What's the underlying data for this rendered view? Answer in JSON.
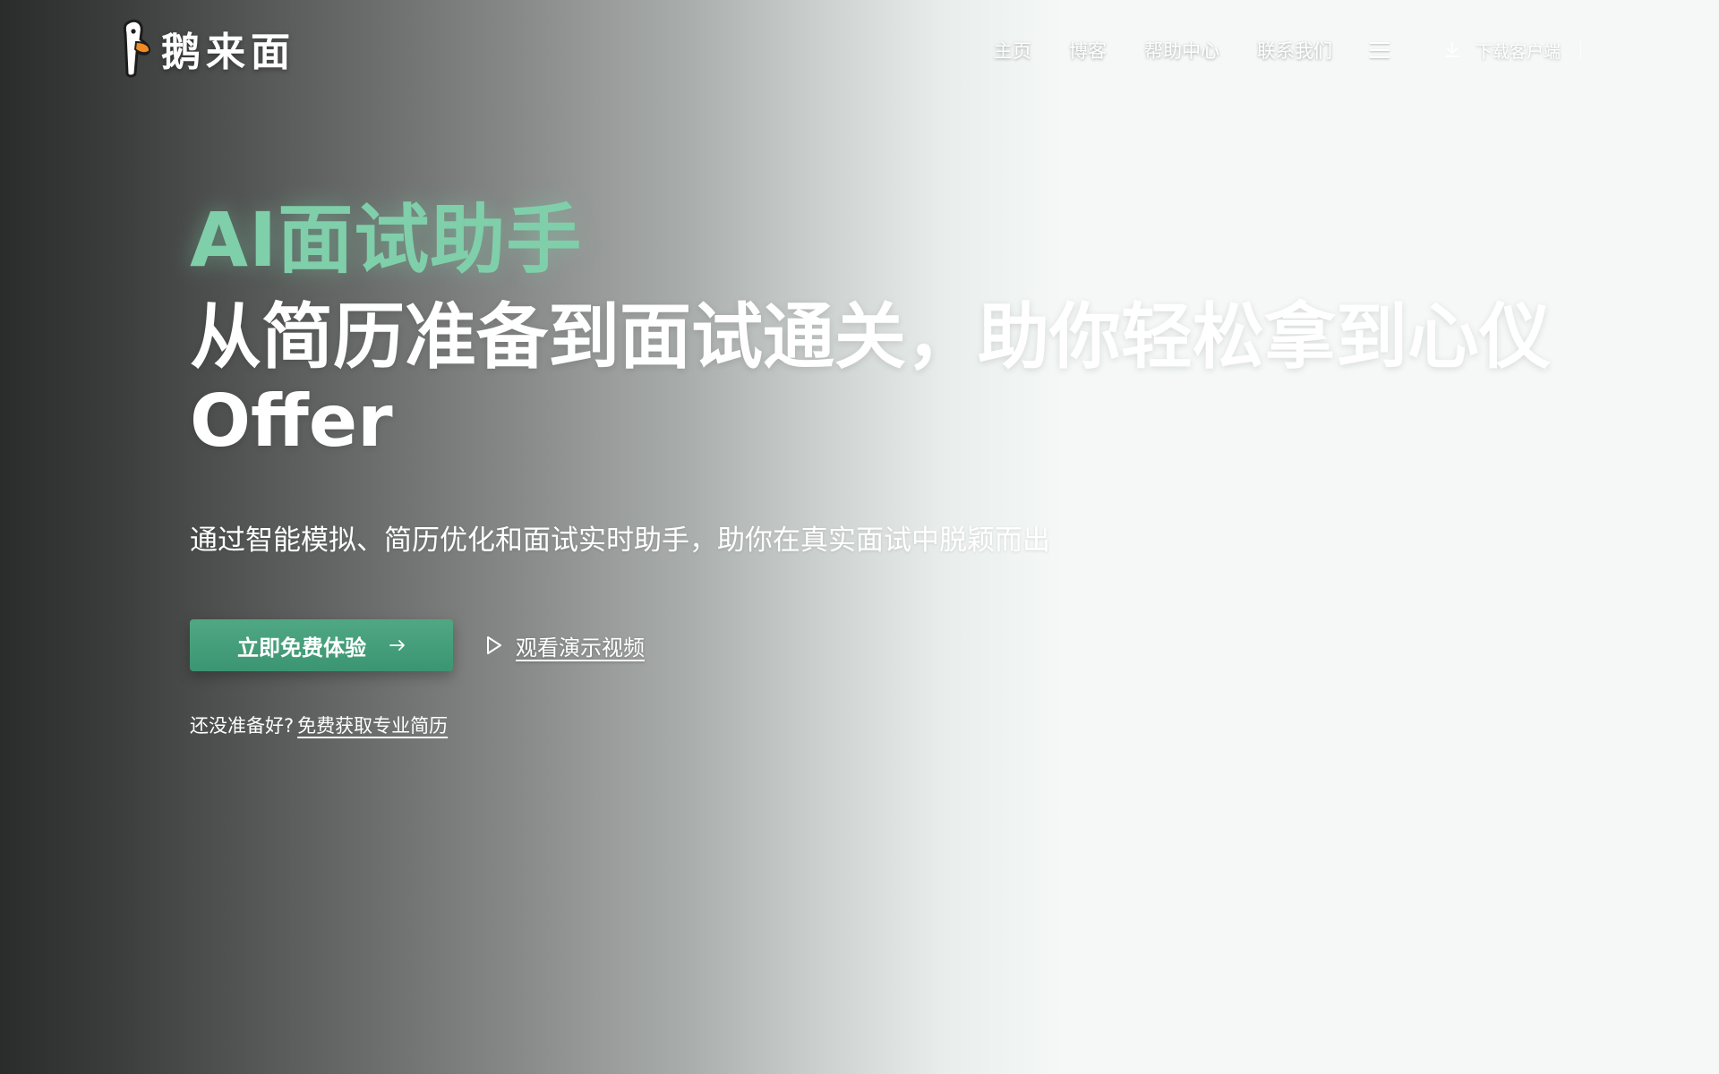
{
  "brand": {
    "name": "鹅来面",
    "logo_icon": "goose-logo-icon"
  },
  "nav": {
    "items": [
      {
        "label": "主页"
      },
      {
        "label": "博客"
      },
      {
        "label": "帮助中心"
      },
      {
        "label": "联系我们"
      }
    ],
    "menu_icon": "hamburger-menu-icon",
    "download_icon": "download-icon",
    "download_label": "下载客户端"
  },
  "hero": {
    "eyebrow": "AI面试助手",
    "headline": "从简历准备到面试通关，助你轻松拿到心仪Offer",
    "subtitle": "通过智能模拟、简历优化和面试实时助手，助你在真实面试中脱颖而出",
    "cta_label": "立即免费体验",
    "cta_icon": "arrow-right-icon",
    "demo_icon": "play-icon",
    "demo_label": "观看演示视频",
    "footnote_prefix": "还没准备好?",
    "footnote_link": "免费获取专业简历"
  },
  "colors": {
    "accent_green": "#4fa883",
    "eyebrow_green": "#7fcfaa",
    "page_background": "#f5f8f7",
    "dark_edge": "#2a2c2c"
  }
}
